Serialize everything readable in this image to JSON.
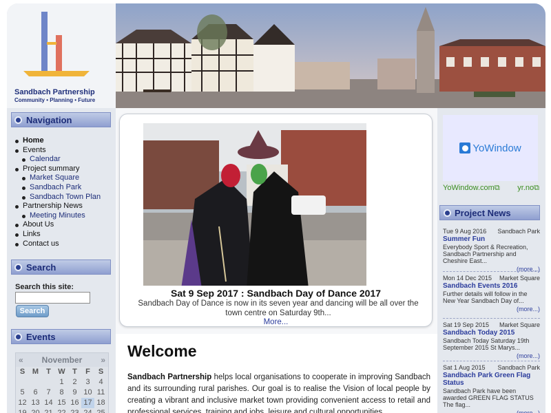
{
  "brand": {
    "name": "Sandbach Partnership",
    "tagline": "Community • Planning • Future"
  },
  "navigation": {
    "title": "Navigation",
    "items": [
      {
        "label": "Home",
        "level": 0,
        "active": true
      },
      {
        "label": "Events",
        "level": 0
      },
      {
        "label": "Calendar",
        "level": 1
      },
      {
        "label": "Project summary",
        "level": 0
      },
      {
        "label": "Market Square",
        "level": 1
      },
      {
        "label": "Sandbach Park",
        "level": 1
      },
      {
        "label": "Sandbach Town Plan",
        "level": 1
      },
      {
        "label": "Partnership News",
        "level": 0
      },
      {
        "label": "Meeting Minutes",
        "level": 1
      },
      {
        "label": "About Us",
        "level": 0
      },
      {
        "label": "Links",
        "level": 0
      },
      {
        "label": "Contact us",
        "level": 0
      }
    ]
  },
  "search": {
    "title": "Search",
    "label": "Search this site:",
    "value": "",
    "button": "Search"
  },
  "events": {
    "title": "Events",
    "month": "November",
    "prev": "«",
    "next": "»",
    "dow": [
      "S",
      "M",
      "T",
      "W",
      "T",
      "F",
      "S"
    ],
    "rows": [
      [
        "",
        "",
        "",
        "1",
        "2",
        "3",
        "4"
      ],
      [
        "5",
        "6",
        "7",
        "8",
        "9",
        "10",
        "11"
      ],
      [
        "12",
        "13",
        "14",
        "15",
        "16",
        "17",
        "18"
      ],
      [
        "19",
        "20",
        "21",
        "22",
        "23",
        "24",
        "25"
      ]
    ],
    "today": "17"
  },
  "feature": {
    "title": "Sat 9 Sep 2017 : Sandbach Day of Dance 2017",
    "text": "Sandbach Day of Dance is now in its seven year and dancing will be all over the town centre on Saturday 9th...",
    "more": "More..."
  },
  "welcome": {
    "title": "Welcome",
    "lead": "Sandbach Partnership",
    "body": " helps local organisations to cooperate in improving Sandbach and its surrounding rural parishes. Our goal is to realise the Vision of local people by creating a vibrant and inclusive market town providing convenient access to retail and professional services, training and jobs, leisure and cultural opportunities."
  },
  "yowindow": {
    "logo_text": "YoWindow",
    "link1": "YoWindow.com",
    "link2": "yr.no",
    "external_icon": "external-link-icon"
  },
  "project_news": {
    "title": "Project News",
    "items": [
      {
        "date": "Tue 9 Aug 2016",
        "category": "Sandbach Park",
        "title": "Summer Fun",
        "body": "Everybody Sport & Recreation, Sandbach Partnership and Cheshire East...",
        "more": "(more...)"
      },
      {
        "date": "Mon 14 Dec 2015",
        "category": "Market Square",
        "title": "Sandbach Events 2016",
        "body": "Further details will follow in the New Year Sandbach Day of...",
        "more": "(more...)"
      },
      {
        "date": "Sat 19 Sep 2015",
        "category": "Market Square",
        "title": "Sandbach Today 2015",
        "body": "Sandbach Today Saturday 19th September  2015 St Marys...",
        "more": "(more...)"
      },
      {
        "date": "Sat 1 Aug 2015",
        "category": "Sandbach Park",
        "title": "Sandbach Park Green Flag Status",
        "body": "Sandbach Park have been awarded  GREEN FLAG STATUS The flag...",
        "more": "(more...)"
      }
    ]
  },
  "colors": {
    "accent": "#1c2c78",
    "link": "#2b3c9c",
    "panel_head": "#8f9fd0"
  }
}
